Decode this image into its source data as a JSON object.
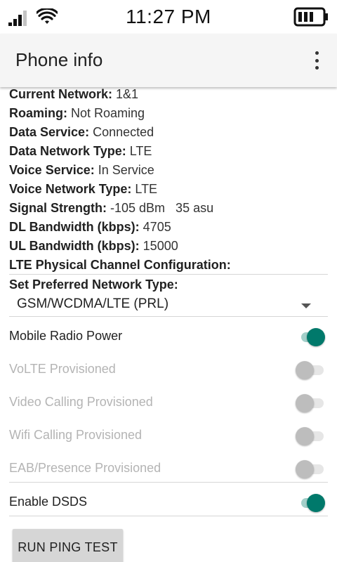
{
  "status_bar": {
    "time": "11:27 PM",
    "icons": [
      "signal-icon",
      "wifi-icon",
      "battery-icon"
    ]
  },
  "app_bar": {
    "title": "Phone info",
    "overflow_icon": "more-vert-icon"
  },
  "info": [
    {
      "key": "Current Network:",
      "value": "1&1"
    },
    {
      "key": "Roaming:",
      "value": "Not Roaming"
    },
    {
      "key": "Data Service:",
      "value": "Connected"
    },
    {
      "key": "Data Network Type:",
      "value": "LTE"
    },
    {
      "key": "Voice Service:",
      "value": "In Service"
    },
    {
      "key": "Voice Network Type:",
      "value": "LTE"
    },
    {
      "key": "Signal Strength:",
      "value": "-105 dBm   35 asu"
    },
    {
      "key": "DL Bandwidth (kbps):",
      "value": "4705"
    },
    {
      "key": "UL Bandwidth (kbps):",
      "value": "15000"
    },
    {
      "key": "LTE Physical Channel Configuration:",
      "value": ""
    }
  ],
  "preferred_network": {
    "label": "Set Preferred Network Type:",
    "selected": "GSM/WCDMA/LTE (PRL)"
  },
  "switches": [
    {
      "label": "Mobile Radio Power",
      "on": true,
      "enabled": true
    },
    {
      "label": "VoLTE Provisioned",
      "on": false,
      "enabled": false
    },
    {
      "label": "Video Calling Provisioned",
      "on": false,
      "enabled": false
    },
    {
      "label": "Wifi Calling Provisioned",
      "on": false,
      "enabled": false
    },
    {
      "label": "EAB/Presence Provisioned",
      "on": false,
      "enabled": false
    },
    {
      "label": "Enable DSDS",
      "on": true,
      "enabled": true
    }
  ],
  "ping_button": {
    "label": "RUN PING TEST"
  },
  "colors": {
    "accent": "#00796b",
    "disabled_text": "#b4b4b4"
  }
}
